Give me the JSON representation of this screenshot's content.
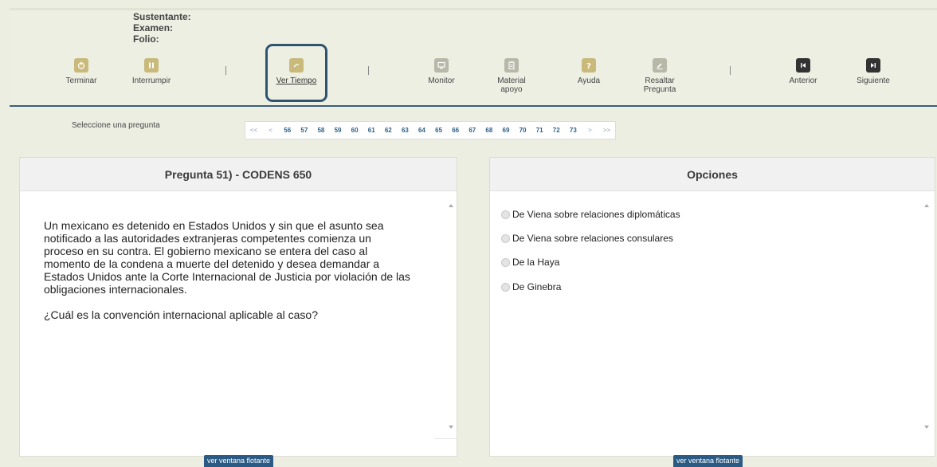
{
  "info": {
    "sustentante": "Sustentante:",
    "examen": "Examen:",
    "folio": "Folio:"
  },
  "toolbar": {
    "terminar": "Terminar",
    "interrumpir": "Interrumpir",
    "ver_tiempo": "Ver Tiempo",
    "monitor": "Monitor",
    "material_1": "Material",
    "material_2": "apoyo",
    "ayuda": "Ayuda",
    "resaltar_1": "Resaltar",
    "resaltar_2": "Pregunta",
    "anterior": "Anterior",
    "siguiente": "Siguiente"
  },
  "nav": {
    "label": "Seleccione una pregunta",
    "first": "<<",
    "prev": "<",
    "pages": [
      "56",
      "57",
      "58",
      "59",
      "60",
      "61",
      "62",
      "63",
      "64",
      "65",
      "66",
      "67",
      "68",
      "69",
      "70",
      "71",
      "72",
      "73"
    ],
    "next": ">",
    "last": ">>"
  },
  "question": {
    "title": "Pregunta 51) - CODENS 650",
    "p1": "Un mexicano es detenido en Estados Unidos y sin que el asunto sea notificado a las autoridades extranjeras competentes comienza un proceso en su contra. El gobierno mexicano se entera del caso al momento de la condena a muerte del detenido y desea demandar a Estados Unidos ante la Corte Internacional de Justicia por violación de las obligaciones internacionales.",
    "p2": "¿Cuál es la convención internacional aplicable al caso?",
    "float_button": "ver ventana flotante"
  },
  "options": {
    "title": "Opciones",
    "items": [
      "De Viena sobre relaciones diplomáticas",
      "De Viena sobre relaciones consulares",
      "De la Haya",
      "De Ginebra"
    ],
    "float_button": "ver ventana flotante"
  },
  "colors": {
    "accent": "#2f5472",
    "gold_icon": "#c9ba7c",
    "gray_icon": "#b8b8a8",
    "dark_icon": "#333333"
  }
}
